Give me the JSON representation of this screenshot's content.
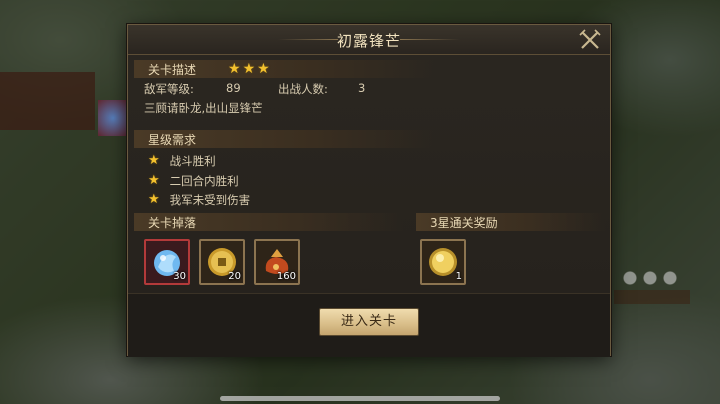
{
  "dialog": {
    "title": "初露锋芒",
    "stage_section": {
      "label": "关卡描述",
      "stars": [
        "★",
        "★",
        "★"
      ],
      "enemy_level_label": "敌军等级:",
      "enemy_level": "89",
      "troops_label": "出战人数:",
      "troops": "3",
      "description": "三顾请卧龙,出山显锋芒"
    },
    "star_section": {
      "label": "星级需求",
      "requirements": [
        "战斗胜利",
        "二回合内胜利",
        "我军未受到伤害"
      ]
    },
    "drops_section": {
      "label": "关卡掉落",
      "items": [
        {
          "name": "blue-orb-item",
          "count": "30"
        },
        {
          "name": "gold-coin-item",
          "count": "20"
        },
        {
          "name": "treasure-bag-item",
          "count": "160"
        }
      ]
    },
    "reward_section": {
      "label": "3星通关奖励",
      "items": [
        {
          "name": "gold-medal-item",
          "count": "1"
        }
      ]
    },
    "enter_button": "进入关卡"
  },
  "colors": {
    "star": "#f3c12e",
    "accent": "#d8bd88",
    "panel": "#25211c"
  }
}
